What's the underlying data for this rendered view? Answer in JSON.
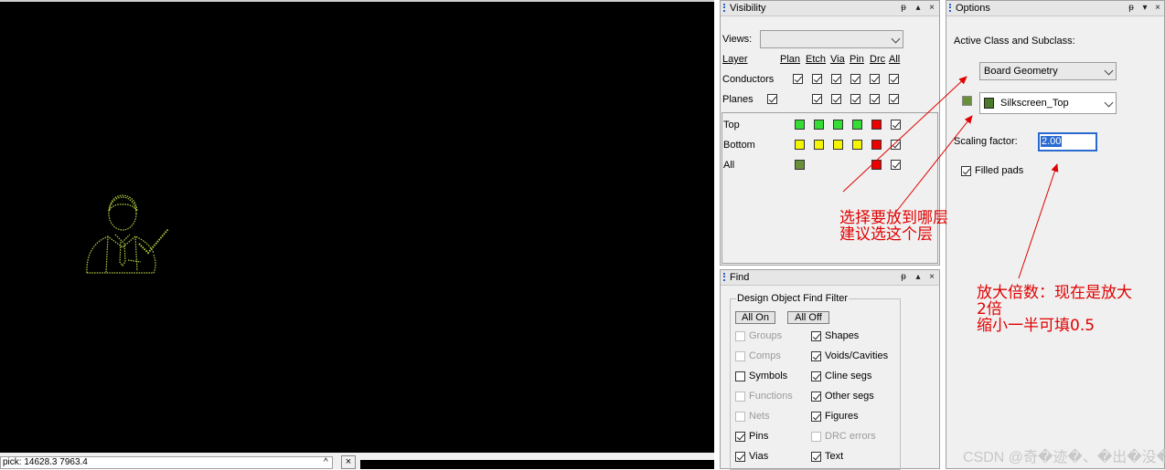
{
  "status": {
    "pick_text": "pick:  14628.3 7963.4",
    "scroll_up": "^",
    "close": "×"
  },
  "visibility": {
    "title": "Visibility",
    "pin": "ᵽ",
    "float": "▴",
    "close": "×",
    "views_label": "Views:",
    "views_value": "",
    "columns": {
      "layer": "Layer",
      "plan": "Plan",
      "etch": "Etch",
      "via": "Via",
      "pin": "Pin",
      "drc": "Drc",
      "all": "All"
    },
    "rows": {
      "conductors": "Conductors",
      "planes": "Planes",
      "top": "Top",
      "bottom": "Bottom",
      "all": "All"
    }
  },
  "find": {
    "title": "Find",
    "pin": "ᵽ",
    "float": "▴",
    "close": "×",
    "filter_title": "Design Object Find Filter",
    "all_on": "All On",
    "all_off": "All Off",
    "left": [
      {
        "label": "Groups",
        "checked": false,
        "disabled": true
      },
      {
        "label": "Comps",
        "checked": false,
        "disabled": true
      },
      {
        "label": "Symbols",
        "checked": false,
        "disabled": false
      },
      {
        "label": "Functions",
        "checked": false,
        "disabled": true
      },
      {
        "label": "Nets",
        "checked": false,
        "disabled": true
      },
      {
        "label": "Pins",
        "checked": true,
        "disabled": false
      },
      {
        "label": "Vias",
        "checked": true,
        "disabled": false
      }
    ],
    "right": [
      {
        "label": "Shapes",
        "checked": true,
        "disabled": false
      },
      {
        "label": "Voids/Cavities",
        "checked": true,
        "disabled": false
      },
      {
        "label": "Cline segs",
        "checked": true,
        "disabled": false
      },
      {
        "label": "Other segs",
        "checked": true,
        "disabled": false
      },
      {
        "label": "Figures",
        "checked": true,
        "disabled": false
      },
      {
        "label": "DRC errors",
        "checked": false,
        "disabled": true
      },
      {
        "label": "Text",
        "checked": true,
        "disabled": false
      }
    ]
  },
  "options": {
    "title": "Options",
    "pin": "ᵽ",
    "float": "▾",
    "close": "×",
    "active_label": "Active Class and Subclass:",
    "class_value": "Board Geometry",
    "subclass_value": "Silkscreen_Top",
    "scaling_label": "Scaling factor:",
    "scaling_value": "2.00",
    "filled_pads_label": "Filled pads",
    "filled_pads_checked": true
  },
  "annotations": {
    "layer_note": "选择要放到哪层\n建议选这个层",
    "scale_note": "放大倍数：现在是放大\n2倍\n缩小一半可填0.5"
  },
  "watermark": "CSDN @奇�迹�、�出�没�",
  "colors": {
    "green": "#33dd33",
    "yellow": "#f5f500",
    "red": "#ee0000",
    "olive": "#6a8f3a",
    "annotation": "#e00000"
  }
}
